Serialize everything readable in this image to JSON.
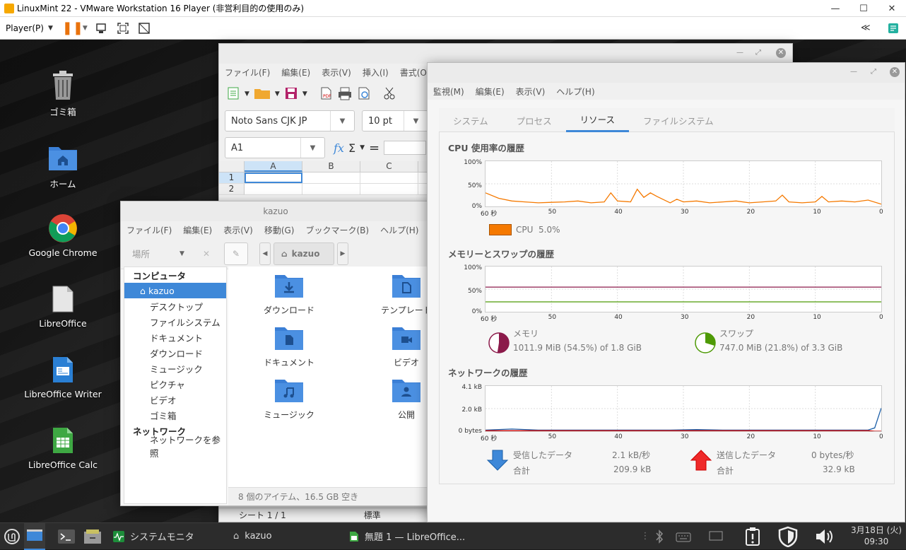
{
  "vm": {
    "title": "LinuxMint 22 - VMware Workstation 16 Player (非営利目的の使用のみ)",
    "player_menu": "Player(P)",
    "collapse_label": "≪"
  },
  "desktop": {
    "icons": [
      {
        "label": "ゴミ箱"
      },
      {
        "label": "ホーム"
      },
      {
        "label": "Google Chrome"
      },
      {
        "label": "LibreOffice"
      },
      {
        "label": "LibreOffice Writer"
      },
      {
        "label": "LibreOffice Calc"
      }
    ]
  },
  "calc": {
    "menu": [
      "ファイル(F)",
      "編集(E)",
      "表示(V)",
      "挿入(I)",
      "書式(O)"
    ],
    "font_name": "Noto Sans CJK JP",
    "font_size": "10 pt",
    "cell_ref": "A1",
    "columns": [
      "A",
      "B",
      "C"
    ],
    "rows": [
      "1",
      "2"
    ],
    "status_sheet": "シート 1 / 1",
    "status_style": "標準"
  },
  "nemo": {
    "title": "kazuo",
    "menu": [
      "ファイル(F)",
      "編集(E)",
      "表示(V)",
      "移動(G)",
      "ブックマーク(B)",
      "ヘルプ(H)"
    ],
    "places_label": "場所",
    "path_label": "kazuo",
    "sidebar": {
      "computer_head": "コンピュータ",
      "items": [
        "kazuo",
        "デスクトップ",
        "ファイルシステム",
        "ドキュメント",
        "ダウンロード",
        "ミュージック",
        "ピクチャ",
        "ビデオ",
        "ゴミ箱"
      ],
      "network_head": "ネットワーク",
      "network_items": [
        "ネットワークを参照"
      ]
    },
    "files": [
      "ダウンロード",
      "テンプレート",
      "ドキュメント",
      "ビデオ",
      "ミュージック",
      "公開"
    ],
    "status": "8 個のアイテム、16.5 GB 空き"
  },
  "sysmon": {
    "menu": [
      "監視(M)",
      "編集(E)",
      "表示(V)",
      "ヘルプ(H)"
    ],
    "tabs": [
      "システム",
      "プロセス",
      "リソース",
      "ファイルシステム"
    ],
    "active_tab": "リソース",
    "cpu_title": "CPU 使用率の履歴",
    "cpu_label": "CPU",
    "cpu_value": "5.0%",
    "mem_title": "メモリーとスワップの履歴",
    "mem_label": "メモリ",
    "mem_value": "1011.9 MiB (54.5%) of 1.8 GiB",
    "swap_label": "スワップ",
    "swap_value": "747.0 MiB (21.8%) of 3.3 GiB",
    "net_title": "ネットワークの履歴",
    "recv_label": "受信したデータ",
    "recv_rate": "2.1 kB/秒",
    "recv_total_label": "合計",
    "recv_total": "209.9 kB",
    "send_label": "送信したデータ",
    "send_rate": "0 bytes/秒",
    "send_total_label": "合計",
    "send_total": "32.9 kB",
    "pct_ticks": [
      "100%",
      "50%",
      "0%"
    ],
    "net_ticks": [
      "4.1 kB",
      "2.0 kB",
      "0 bytes"
    ],
    "x_ticks": [
      "60 秒",
      "50",
      "40",
      "30",
      "20",
      "10",
      "0"
    ],
    "colors": {
      "cpu": "#f57900",
      "mem": "#8b1a4a",
      "swap": "#4e9a06",
      "recv": "#1c5fa8",
      "send": "#cc0000"
    }
  },
  "chart_data": [
    {
      "type": "line",
      "title": "CPU 使用率の履歴",
      "ylim": [
        0,
        100
      ],
      "x": [
        60,
        58,
        56,
        54,
        52,
        50,
        48,
        46,
        44,
        42,
        41,
        40,
        38,
        37,
        36,
        35,
        34,
        32,
        31,
        30,
        28,
        26,
        24,
        22,
        20,
        18,
        16,
        15,
        14,
        12,
        10,
        9,
        8,
        6,
        4,
        2,
        0
      ],
      "series": [
        {
          "name": "CPU",
          "values": [
            30,
            18,
            12,
            10,
            8,
            9,
            10,
            12,
            8,
            10,
            30,
            12,
            10,
            38,
            20,
            30,
            22,
            8,
            16,
            10,
            12,
            8,
            10,
            12,
            8,
            10,
            12,
            25,
            10,
            8,
            10,
            22,
            10,
            12,
            10,
            14,
            5
          ]
        }
      ]
    },
    {
      "type": "line",
      "title": "メモリーとスワップの履歴",
      "ylim": [
        0,
        100
      ],
      "x": [
        60,
        0
      ],
      "series": [
        {
          "name": "メモリ",
          "values": [
            54.5,
            54.5
          ]
        },
        {
          "name": "スワップ",
          "values": [
            21.8,
            21.8
          ]
        }
      ]
    },
    {
      "type": "line",
      "title": "ネットワークの履歴",
      "ylim": [
        0,
        4.1
      ],
      "x": [
        60,
        56,
        52,
        48,
        44,
        40,
        36,
        32,
        28,
        24,
        20,
        16,
        12,
        8,
        4,
        2,
        1,
        0
      ],
      "series": [
        {
          "name": "受信したデータ",
          "values": [
            0.1,
            0.2,
            0.1,
            0.1,
            0.1,
            0.1,
            0.1,
            0.1,
            0.15,
            0.1,
            0.1,
            0.1,
            0.1,
            0.1,
            0.1,
            0.1,
            0.3,
            2.1
          ]
        },
        {
          "name": "送信したデータ",
          "values": [
            0.05,
            0.05,
            0.05,
            0.05,
            0.05,
            0.05,
            0.05,
            0.05,
            0.05,
            0.05,
            0.05,
            0.05,
            0.05,
            0.05,
            0.05,
            0.05,
            0,
            0
          ]
        }
      ]
    }
  ],
  "taskbar": {
    "sysmon_label": "システムモニタ",
    "nemo_label": "kazuo",
    "calc_label": "無題 1 — LibreOffice...",
    "date": "3月18日 (火)",
    "time": "09:30"
  }
}
